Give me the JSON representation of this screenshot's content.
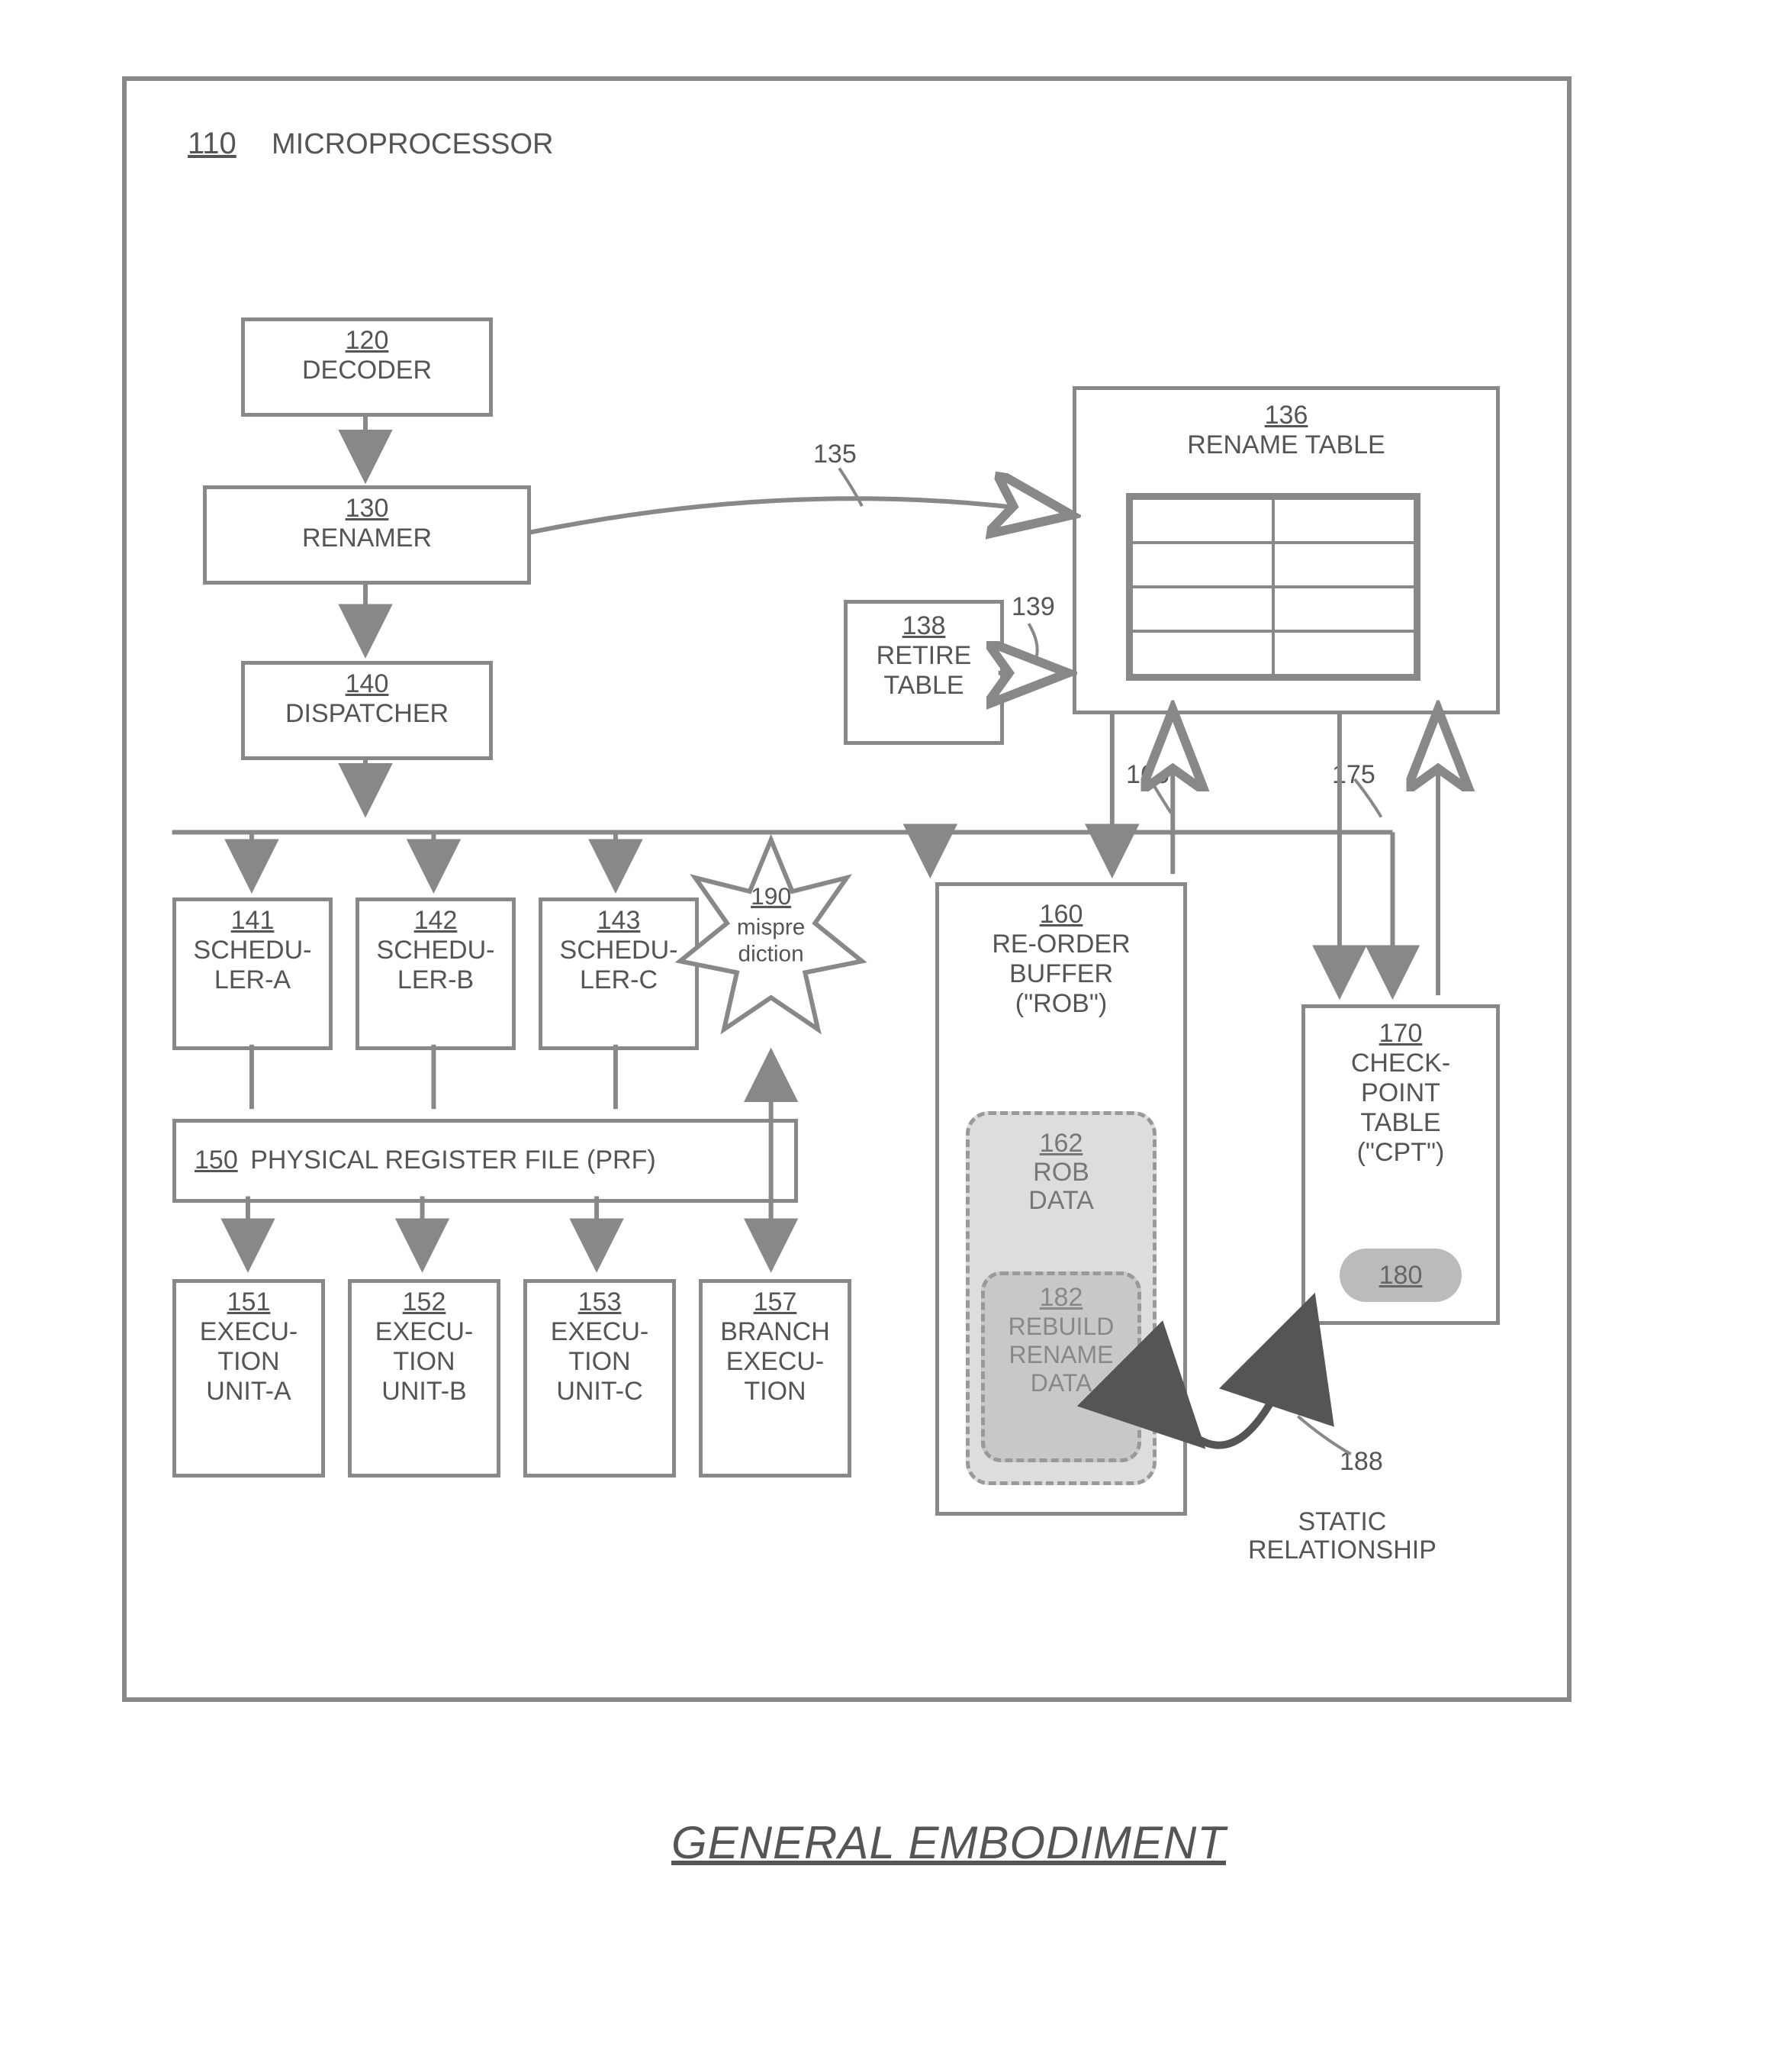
{
  "title_ref": "110",
  "title_text": "MICROPROCESSOR",
  "blocks": {
    "decoder": {
      "ref": "120",
      "label": "DECODER"
    },
    "renamer": {
      "ref": "130",
      "label": "RENAMER"
    },
    "dispatcher": {
      "ref": "140",
      "label": "DISPATCHER"
    },
    "rename_table": {
      "ref": "136",
      "label": "RENAME TABLE"
    },
    "retire_table": {
      "ref": "138",
      "label": "RETIRE\nTABLE"
    },
    "sched_a": {
      "ref": "141",
      "label": "SCHEDU-\nLER-A"
    },
    "sched_b": {
      "ref": "142",
      "label": "SCHEDU-\nLER-B"
    },
    "sched_c": {
      "ref": "143",
      "label": "SCHEDU-\nLER-C"
    },
    "prf": {
      "ref": "150",
      "label": "PHYSICAL REGISTER FILE (PRF)"
    },
    "exec_a": {
      "ref": "151",
      "label": "EXECU-\nTION\nUNIT-A"
    },
    "exec_b": {
      "ref": "152",
      "label": "EXECU-\nTION\nUNIT-B"
    },
    "exec_c": {
      "ref": "153",
      "label": "EXECU-\nTION\nUNIT-C"
    },
    "branch_exec": {
      "ref": "157",
      "label": "BRANCH\nEXECU-\nTION"
    },
    "rob": {
      "ref": "160",
      "label": "RE-ORDER\nBUFFER\n(\"ROB\")"
    },
    "rob_data": {
      "ref": "162",
      "label": "ROB\nDATA"
    },
    "rebuild": {
      "ref": "182",
      "label": "REBUILD\nRENAME\nDATA"
    },
    "cpt": {
      "ref": "170",
      "label": "CHECK-\nPOINT\nTABLE\n(\"CPT\")"
    },
    "cpt_inner": {
      "ref": "180"
    },
    "mispre": {
      "ref": "190",
      "label": "mispre\ndiction"
    }
  },
  "callouts": {
    "c135": "135",
    "c139": "139",
    "c165": "165",
    "c175": "175",
    "c188": "188"
  },
  "static_rel": "STATIC\nRELATIONSHIP",
  "caption": "GENERAL EMBODIMENT"
}
